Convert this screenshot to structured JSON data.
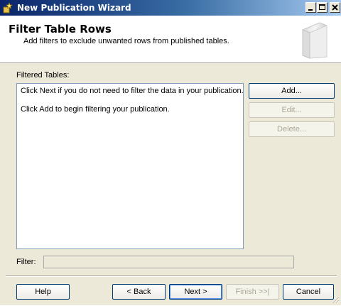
{
  "window": {
    "title": "New Publication Wizard",
    "controls": {
      "minimize": "minimize",
      "maximize": "maximize",
      "close": "close"
    }
  },
  "header": {
    "title": "Filter Table Rows",
    "subtitle": "Add filters to exclude unwanted rows from published tables."
  },
  "filtered_tables": {
    "label": "Filtered Tables:",
    "lines": [
      "Click Next if you do not need to filter the data in your publication.",
      "Click Add to begin filtering your publication."
    ]
  },
  "side_buttons": {
    "add": "Add...",
    "edit": "Edit...",
    "delete": "Delete..."
  },
  "filter": {
    "label": "Filter:",
    "value": ""
  },
  "footer": {
    "help": "Help",
    "back": "< Back",
    "next": "Next >",
    "finish": "Finish >>|",
    "cancel": "Cancel"
  },
  "colors": {
    "dialog_bg": "#ece9d8",
    "title_bar_start": "#0a246a",
    "title_bar_end": "#a6caf0",
    "disabled_text": "#aca899"
  },
  "icons": [
    "wizard-icon",
    "minimize-icon",
    "maximize-icon",
    "close-icon",
    "book-icon",
    "resize-grip-icon"
  ]
}
